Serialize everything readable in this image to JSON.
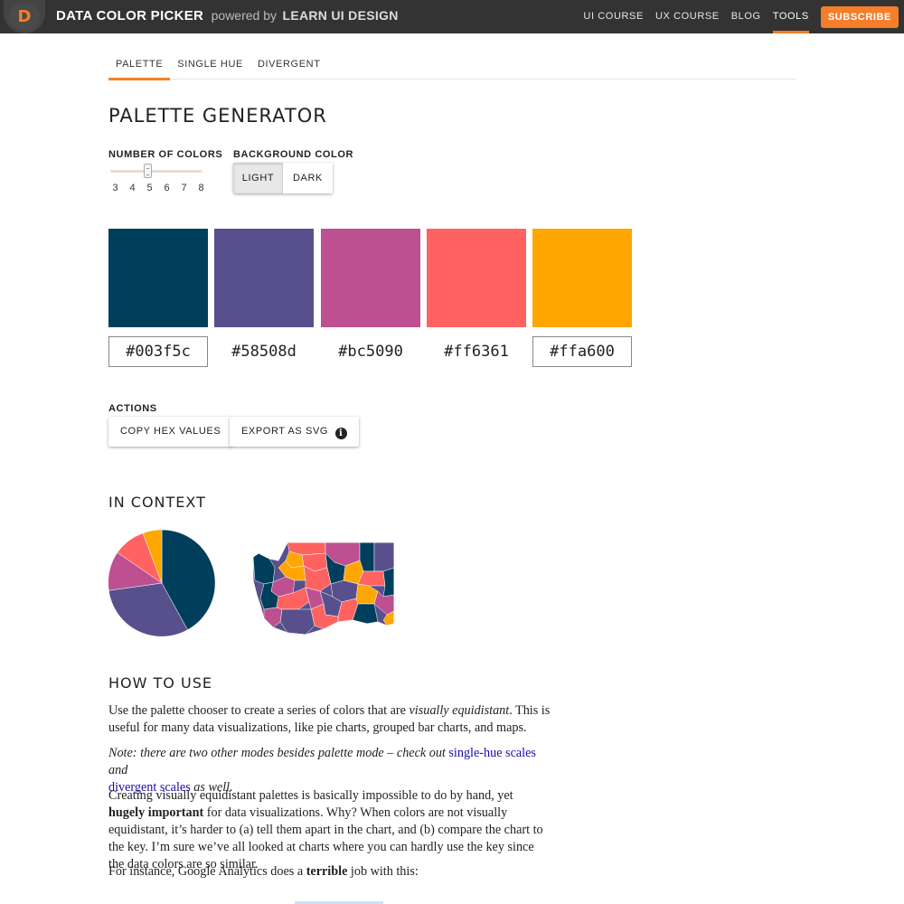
{
  "header": {
    "logo_letter": "D",
    "brand_title": "DATA COLOR PICKER",
    "powered_by": "powered by",
    "brand_partner": "LEARN UI DESIGN",
    "nav": [
      "UI COURSE",
      "UX COURSE",
      "BLOG",
      "TOOLS"
    ],
    "active_nav": "TOOLS",
    "subscribe_label": "SUBSCRIBE",
    "accent": "#f57e2a"
  },
  "tabs": [
    "PALETTE",
    "SINGLE HUE",
    "DIVERGENT"
  ],
  "active_tab": "PALETTE",
  "main": {
    "title": "PALETTE GENERATOR",
    "number_of_colors": {
      "label": "NUMBER OF COLORS",
      "ticks": [
        "3",
        "4",
        "5",
        "6",
        "7",
        "8"
      ],
      "value": 5
    },
    "background_color": {
      "label": "BACKGROUND COLOR",
      "options": [
        "LIGHT",
        "DARK"
      ],
      "selected": "LIGHT"
    },
    "palette": [
      "#003f5c",
      "#58508d",
      "#bc5090",
      "#ff6361",
      "#ffa600"
    ],
    "actions": {
      "label": "ACTIONS",
      "copy_label": "COPY HEX VALUES",
      "export_label": "EXPORT AS SVG",
      "info_icon": "info-icon"
    }
  },
  "context": {
    "title": "IN CONTEXT"
  },
  "how_to_use": {
    "title": "HOW TO USE",
    "p1_a": "Use the palette chooser to create a series of colors that are ",
    "p1_em": "visually equidistant",
    "p1_b": ". This is useful for many data visualizations, like pie charts, grouped bar charts, and maps.",
    "p2_a": "Note: there are two other modes besides palette mode – check out ",
    "p2_link1": "single-hue scales",
    "p2_b": " and ",
    "p2_link2": "divergent scales",
    "p2_c": " as well.",
    "p3_a": "Creating visually equidistant palettes is basically impossible to do by hand, yet ",
    "p3_strong": "hugely important",
    "p3_b": " for data visualizations. Why? When colors are not visually equidistant, it’s harder to (a) tell them apart in the chart, and (b) compare the chart to the key. I’m sure we’ve all looked at charts where you can hardly use the key since the data colors are so similar.",
    "p4_a": "For instance, Google Analytics does a ",
    "p4_strong": "terrible",
    "p4_b": " job with this:"
  }
}
